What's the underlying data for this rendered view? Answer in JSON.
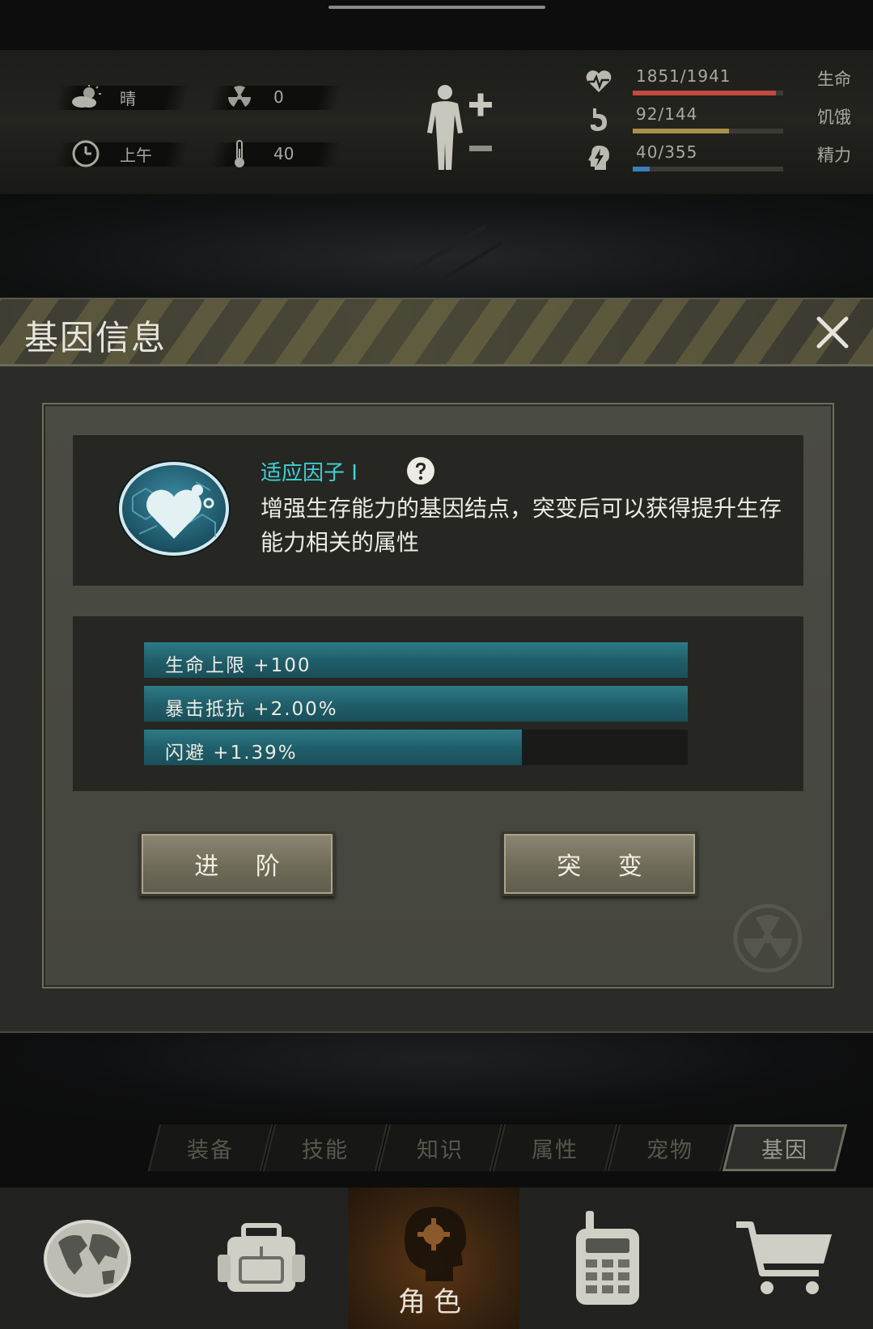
{
  "status": {
    "weather": {
      "icon": "partly-cloudy-icon",
      "label": "晴"
    },
    "radiation": {
      "icon": "radiation-icon",
      "value": "0"
    },
    "time": {
      "icon": "clock-icon",
      "label": "上午"
    },
    "temperature": {
      "icon": "thermometer-icon",
      "value": "40"
    },
    "stats": [
      {
        "icon": "heart-pulse-icon",
        "value": "1851/1941",
        "name": "生命",
        "fraction": 0.954,
        "color": "#c44a3f"
      },
      {
        "icon": "stomach-icon",
        "value": "92/144",
        "name": "饥饿",
        "fraction": 0.639,
        "color": "#a8914a"
      },
      {
        "icon": "energy-head-icon",
        "value": "40/355",
        "name": "精力",
        "fraction": 0.113,
        "color": "#3a7fb5"
      }
    ]
  },
  "modal": {
    "title": "基因信息",
    "gene": {
      "name": "适应因子 I",
      "description": "增强生存能力的基因结点，突变后可以获得提升生存能力相关的属性"
    },
    "attributes": [
      {
        "label": "生命上限 +100",
        "fraction": 1.0
      },
      {
        "label": "暴击抵抗 +2.00%",
        "fraction": 1.0
      },
      {
        "label": "闪避 +1.39%",
        "fraction": 0.695
      }
    ],
    "buttons": {
      "advance": "进 阶",
      "mutate": "突 变"
    }
  },
  "tabs": [
    {
      "label": "装备",
      "active": false
    },
    {
      "label": "技能",
      "active": false
    },
    {
      "label": "知识",
      "active": false
    },
    {
      "label": "属性",
      "active": false
    },
    {
      "label": "宠物",
      "active": false
    },
    {
      "label": "基因",
      "active": true
    }
  ],
  "nav": {
    "items": [
      {
        "icon": "globe-icon"
      },
      {
        "icon": "backpack-icon"
      },
      {
        "icon": "character-head-icon",
        "label": "角色",
        "active": true
      },
      {
        "icon": "walkie-talkie-icon"
      },
      {
        "icon": "shopping-cart-icon"
      }
    ]
  },
  "colors": {
    "accent": "#3fd0d6",
    "bar_fill": "#2d7a86",
    "active_nav": "#5b3513"
  }
}
